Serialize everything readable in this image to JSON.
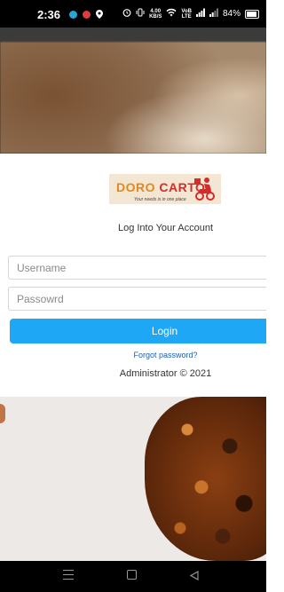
{
  "status_bar": {
    "time": "2:36",
    "network_speed_value": "4.00",
    "network_speed_unit": "KB/S",
    "network_type": "VoB",
    "network_sub": "LTE",
    "battery": "84%"
  },
  "logo": {
    "name_part1": "DORO ",
    "name_part2": "CARTO",
    "tagline": "Your needs is in one place"
  },
  "login": {
    "title": "Log Into Your Account",
    "username_placeholder": "Username",
    "password_placeholder": "Passowrd",
    "login_button": "Login",
    "forgot_link": "Forgot password?",
    "footer": "Administrator © 2021"
  },
  "colors": {
    "accent": "#1ea7f5",
    "link": "#1a5fb4"
  }
}
